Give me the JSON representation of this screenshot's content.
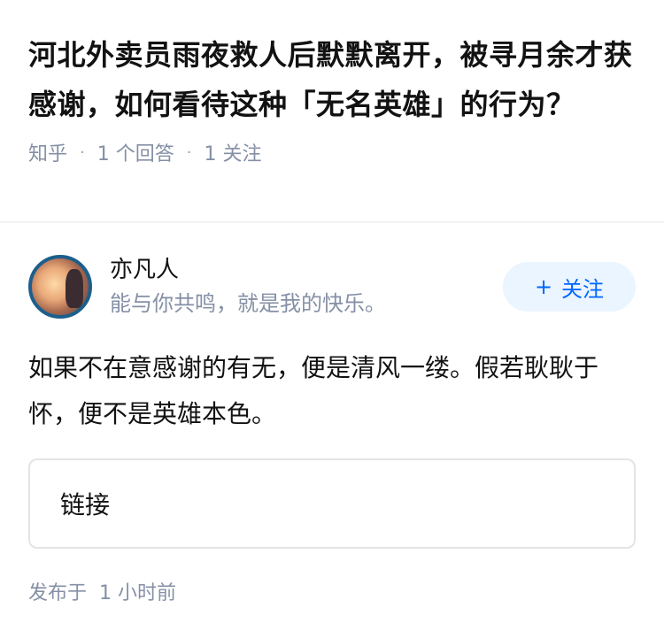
{
  "question": {
    "title": "河北外卖员雨夜救人后默默离开，被寻月余才获感谢，如何看待这种「无名英雄」的行为？",
    "meta": {
      "source": "知乎",
      "answers": "1 个回答",
      "followers": "1 关注"
    }
  },
  "answer": {
    "author": {
      "name": "亦凡人",
      "bio": "能与你共鸣，就是我的快乐。",
      "follow_label": "关注",
      "follow_icon": "plus-icon"
    },
    "content": "如果不在意感谢的有无，便是清风一缕。假若耿耿于怀，便不是英雄本色。",
    "link_label": "链接",
    "published_prefix": "发布于",
    "published_time": "1 小时前"
  },
  "colors": {
    "accent": "#0066ff",
    "follow_bg": "#ebf5ff",
    "meta_text": "#8590a6",
    "avatar_ring": "#1c5f8c"
  }
}
